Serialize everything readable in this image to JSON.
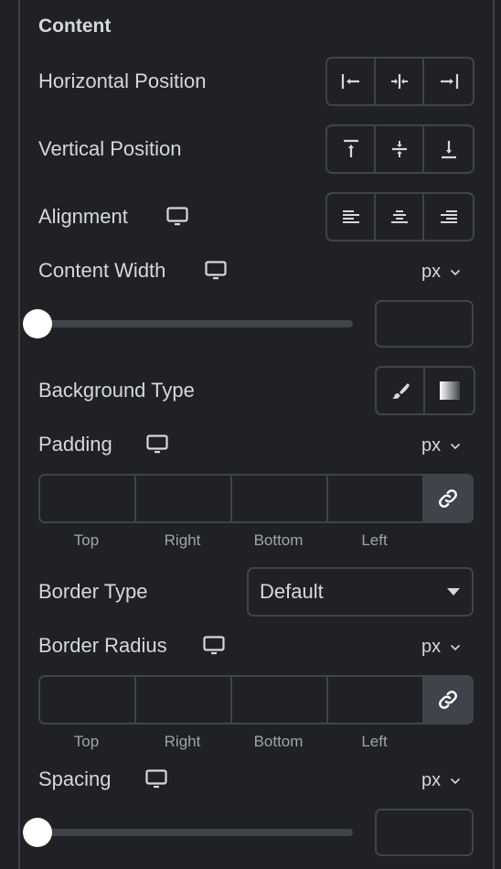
{
  "section": {
    "title": "Content"
  },
  "horizontal_position": {
    "label": "Horizontal Position",
    "options": [
      {
        "name": "start",
        "icon": "align-start-horizontal-icon"
      },
      {
        "name": "center",
        "icon": "align-center-horizontal-icon"
      },
      {
        "name": "end",
        "icon": "align-end-horizontal-icon"
      }
    ]
  },
  "vertical_position": {
    "label": "Vertical Position",
    "options": [
      {
        "name": "top",
        "icon": "align-top-icon"
      },
      {
        "name": "middle",
        "icon": "align-middle-icon"
      },
      {
        "name": "bottom",
        "icon": "align-bottom-icon"
      }
    ]
  },
  "alignment": {
    "label": "Alignment",
    "responsive_icon": "desktop-icon",
    "options": [
      {
        "name": "left",
        "icon": "text-align-left-icon"
      },
      {
        "name": "center",
        "icon": "text-align-center-icon"
      },
      {
        "name": "right",
        "icon": "text-align-right-icon"
      }
    ]
  },
  "content_width": {
    "label": "Content Width",
    "responsive_icon": "desktop-icon",
    "unit": "px",
    "slider_value": 0,
    "input_value": ""
  },
  "background_type": {
    "label": "Background Type",
    "options": [
      {
        "name": "classic",
        "icon": "paint-brush-icon"
      },
      {
        "name": "gradient",
        "icon": "gradient-icon"
      }
    ]
  },
  "padding": {
    "label": "Padding",
    "responsive_icon": "desktop-icon",
    "unit": "px",
    "fields": [
      {
        "label": "Top",
        "value": ""
      },
      {
        "label": "Right",
        "value": ""
      },
      {
        "label": "Bottom",
        "value": ""
      },
      {
        "label": "Left",
        "value": ""
      }
    ],
    "linked_icon": "link-icon"
  },
  "border_type": {
    "label": "Border Type",
    "selected": "Default"
  },
  "border_radius": {
    "label": "Border Radius",
    "responsive_icon": "desktop-icon",
    "unit": "px",
    "fields": [
      {
        "label": "Top",
        "value": ""
      },
      {
        "label": "Right",
        "value": ""
      },
      {
        "label": "Bottom",
        "value": ""
      },
      {
        "label": "Left",
        "value": ""
      }
    ],
    "linked_icon": "link-icon"
  },
  "spacing": {
    "label": "Spacing",
    "responsive_icon": "desktop-icon",
    "unit": "px",
    "slider_value": 0,
    "input_value": ""
  },
  "colors": {
    "background": "#1f2124",
    "border": "#3f444b",
    "text": "#d5d8dc",
    "muted_text": "#9da5ae",
    "thumb": "#ffffff"
  }
}
